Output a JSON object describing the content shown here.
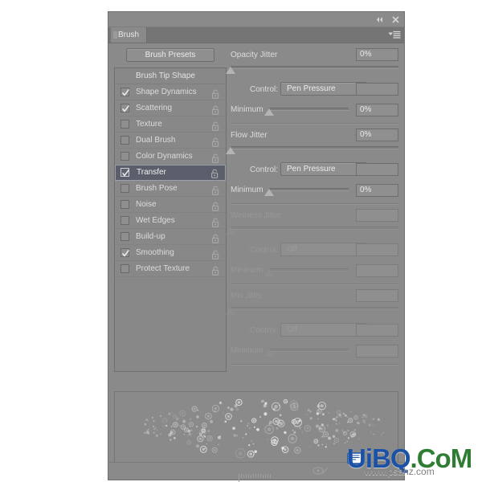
{
  "window": {
    "collapse_icon": "collapse-double-left-icon",
    "close_icon": "close-icon"
  },
  "tab": {
    "label": "Brush",
    "menu_icon": "panel-menu-icon"
  },
  "left_panel": {
    "presets_button": "Brush Presets",
    "header": "Brush Tip Shape",
    "options": [
      {
        "label": "Shape Dynamics",
        "checked": true,
        "selected": false,
        "lock_icon": "unlock-icon"
      },
      {
        "label": "Scattering",
        "checked": true,
        "selected": false,
        "lock_icon": "unlock-icon"
      },
      {
        "label": "Texture",
        "checked": false,
        "selected": false,
        "lock_icon": "unlock-icon"
      },
      {
        "label": "Dual Brush",
        "checked": false,
        "selected": false,
        "lock_icon": "unlock-icon"
      },
      {
        "label": "Color Dynamics",
        "checked": false,
        "selected": false,
        "lock_icon": "unlock-icon"
      },
      {
        "label": "Transfer",
        "checked": true,
        "selected": true,
        "lock_icon": "unlock-icon"
      },
      {
        "label": "Brush Pose",
        "checked": false,
        "selected": false,
        "lock_icon": "unlock-icon"
      },
      {
        "label": "Noise",
        "checked": false,
        "selected": false,
        "lock_icon": "unlock-icon"
      },
      {
        "label": "Wet Edges",
        "checked": false,
        "selected": false,
        "lock_icon": "unlock-icon"
      },
      {
        "label": "Build-up",
        "checked": false,
        "selected": false,
        "lock_icon": "unlock-icon"
      },
      {
        "label": "Smoothing",
        "checked": true,
        "selected": false,
        "lock_icon": "unlock-icon"
      },
      {
        "label": "Protect Texture",
        "checked": false,
        "selected": false,
        "lock_icon": "unlock-icon"
      }
    ]
  },
  "right_panel": {
    "groups": [
      {
        "title": "Opacity Jitter",
        "value": "0%",
        "slider_percent": 0,
        "enabled": true,
        "control_label": "Control:",
        "control_value": "Pen Pressure",
        "control_extra_value": "",
        "minimum_label": "Minimum",
        "minimum_value": "0%",
        "minimum_percent": 0
      },
      {
        "title": "Flow Jitter",
        "value": "0%",
        "slider_percent": 0,
        "enabled": true,
        "control_label": "Control:",
        "control_value": "Pen Pressure",
        "control_extra_value": "",
        "minimum_label": "Minimum",
        "minimum_value": "0%",
        "minimum_percent": 0
      },
      {
        "title": "Wetness Jitter",
        "value": "",
        "slider_percent": 0,
        "enabled": false,
        "control_label": "Control:",
        "control_value": "Off",
        "control_extra_value": "",
        "minimum_label": "Minimum",
        "minimum_value": "",
        "minimum_percent": 0
      },
      {
        "title": "Mix Jitter",
        "value": "",
        "slider_percent": 0,
        "enabled": false,
        "control_label": "Control:",
        "control_value": "Off",
        "control_extra_value": "",
        "minimum_label": "Minimum",
        "minimum_value": "",
        "minimum_percent": 0
      }
    ]
  },
  "preview": {
    "name": "brush-stroke-preview"
  },
  "footer": {
    "toggle_icon": "brush-preview-toggle-icon",
    "grip_icon": "resize-grip-icon"
  },
  "watermark": {
    "text_parts": [
      {
        "text": "U",
        "color": "#1b52a6"
      },
      {
        "text": "i",
        "color": "#1b52a6"
      },
      {
        "text": "B",
        "color": "#1b52a6"
      },
      {
        "text": "Q",
        "color": "#1b52a6"
      },
      {
        "text": ".",
        "color": "#2e7d32"
      },
      {
        "text": "C",
        "color": "#2e7d32"
      },
      {
        "text": "o",
        "color": "#2e7d32"
      },
      {
        "text": "M",
        "color": "#2e7d32"
      }
    ],
    "subtitle": "www.psanz.com",
    "badge_icon": "site-badge-icon"
  },
  "colors": {
    "panel_bg": "#8a8a8a",
    "panel_border": "#6f6f6f",
    "selection": "#5b5f6b",
    "text": "#dcdcdc",
    "text_dim": "#989898",
    "watermark_blue": "#1b52a6",
    "watermark_green": "#2e7d32"
  }
}
